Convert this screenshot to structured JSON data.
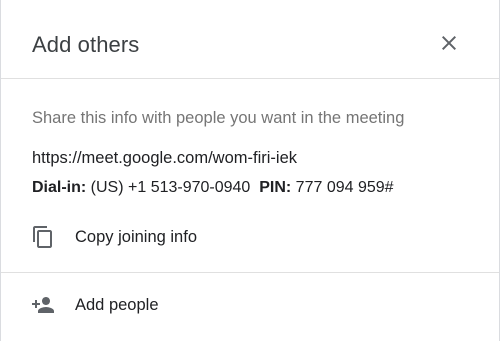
{
  "dialog": {
    "title": "Add others",
    "close_icon": "close-icon"
  },
  "share": {
    "hint": "Share this info with people you want in the meeting",
    "meeting_link": "https://meet.google.com/wom-firi-iek",
    "dialin_label": "Dial-in:",
    "dialin_number": "(US) +1 513-970-0940",
    "pin_label": "PIN:",
    "pin_value": "777 094 959#"
  },
  "actions": {
    "copy_label": "Copy joining info",
    "copy_icon": "copy-icon",
    "add_people_label": "Add people",
    "add_people_icon": "person-add-icon"
  },
  "colors": {
    "title": "#3c4043",
    "hint": "#757575",
    "text": "#202124",
    "icon": "#5f6368",
    "divider": "#e0e0e0"
  }
}
